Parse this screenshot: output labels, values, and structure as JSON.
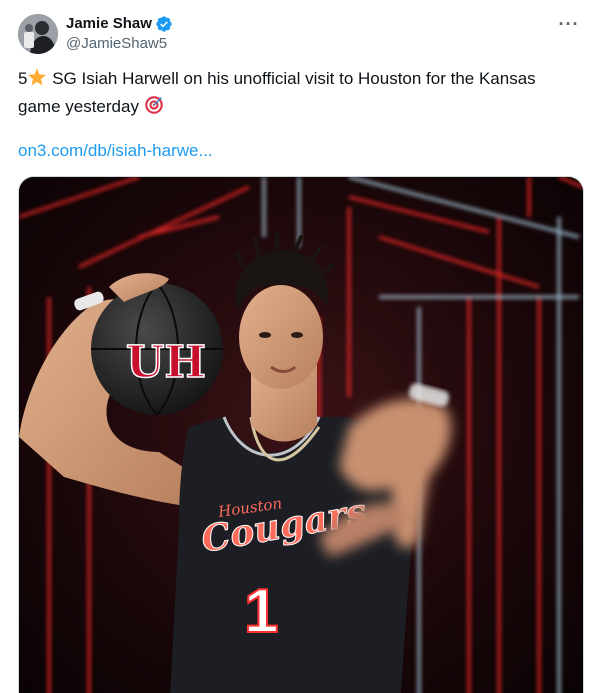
{
  "author": {
    "display_name": "Jamie Shaw",
    "handle": "@JamieShaw5",
    "avatar_icon": "avatar-photo",
    "verified_icon": "verified-badge-icon",
    "verified_color": "#1d9bf0"
  },
  "more_icon": "more-options-icon",
  "tweet": {
    "rank": "5",
    "star_icon": "star-emoji-icon",
    "text_main": " SG Isiah Harwell on his unofficial visit to Houston for the Kansas game yesterday ",
    "target_icon": "direct-hit-emoji-icon",
    "link_text": "on3.com/db/isiah-harwe..."
  },
  "media": {
    "description_icon": "player-photo",
    "jersey_text": "Cougars",
    "jersey_script": "Houston",
    "jersey_number": "1",
    "ball_logo": "UH"
  },
  "colors": {
    "link": "#1d9bf0",
    "text": "#0f1419",
    "secondary": "#536471",
    "neon_red": "#ff2a2a"
  }
}
